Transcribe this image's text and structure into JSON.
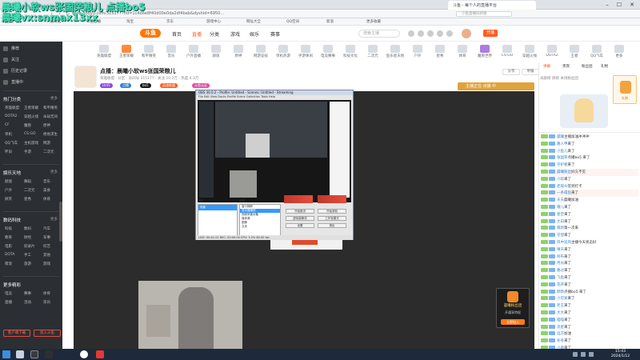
{
  "overlay": {
    "line1": "晨曦小软ws张国荣粮儿 点播bo5",
    "line2": "晨曦vx:snmax13xx"
  },
  "browser": {
    "tab_title": "斗鱼 - 每个人的直播平台",
    "url": "www.douyu.com/315177?rid=1c4d6e8f40d00e0da2df4bab&dyshid=6950...",
    "search_placeholder": "小鱼直播间新版",
    "bookmarks": [
      "百度一下",
      "天猫精选",
      "斗鱼直播",
      "淘宝",
      "京东",
      "游戏中心",
      "网址大全",
      "QQ空间",
      "新浪",
      "更多收藏"
    ]
  },
  "site": {
    "logo": "斗鱼",
    "nav": [
      "首页",
      "直播",
      "分类",
      "游戏",
      "娱乐",
      "赛事"
    ],
    "active_nav": "直播",
    "search_placeholder": "搜索主播",
    "open_live": "开播"
  },
  "categories": {
    "count": "12",
    "count_label": "推荐分类",
    "items": [
      "英雄联盟",
      "王者荣耀",
      "和平精英",
      "音乐",
      "户外直播",
      "颜值",
      "原神",
      "网游竞技",
      "单机热游",
      "手游休闲",
      "电竞赛事",
      "科技文化",
      "二次元",
      "鱼乐星天地",
      "户外",
      "星秀",
      "体育",
      "魔兽世界",
      "CS:GO",
      "穿越火线",
      "DOTA2",
      "王者",
      "QQ飞车",
      "更多"
    ]
  },
  "sidebar": {
    "top_items": [
      "推荐",
      "关注",
      "历史记录",
      "直播中"
    ],
    "sections": [
      {
        "title": "热门分类",
        "more": "更多",
        "cells": [
          "英雄联盟",
          "王者荣耀",
          "和平精英",
          "DOTA2",
          "穿越火线",
          "永劫无间",
          "CF",
          "魔兽",
          "原神",
          "单机",
          "CS:GO",
          "绝地求生",
          "QQ飞车",
          "主机游戏",
          "网游",
          "怀旧",
          "手游",
          "二次元"
        ]
      },
      {
        "title": "娱乐天地",
        "more": "更多",
        "cells": [
          "颜值",
          "舞蹈",
          "音乐",
          "户外",
          "二次元",
          "美食",
          "搞笑",
          "星秀",
          "体育"
        ]
      },
      {
        "title": "数码科技",
        "more": "更多",
        "cells": [
          "科技",
          "数码",
          "汽车",
          "教育",
          "财经",
          "军事",
          "电影",
          "纪录片",
          "综艺",
          "DOTA",
          "手工",
          "其他",
          "萌宠",
          "旅游",
          "游戏"
        ]
      },
      {
        "title": "更多精彩",
        "more": "",
        "cells": [
          "电竞",
          "赛事",
          "体育",
          "直播",
          "活动",
          "资讯"
        ]
      }
    ],
    "footer_buttons": [
      "客户端下载",
      "加入斗鱼"
    ]
  },
  "room": {
    "title": "点播：晨曦小软ws张国荣粮儿",
    "sub": "英雄联盟 · 分区 · 房间号 315177 · 关注 10.2万 · 热度 4.3万",
    "tags": [
      "LV45",
      "点播",
      "bo5",
      "英雄联盟",
      "斗鱼认证"
    ],
    "buttons": [
      "分享",
      "举报"
    ],
    "banner": "主播正在 点播 中"
  },
  "video": {
    "obs_title": "OBS 30.0.2 - Profile: Untitled - Scenes: Untitled - Streaming",
    "obs_menu": "File Edit View Docks Profile Scene Collection Tools Help",
    "obs_status": "LIVE: 00:41:22 REC: 00:00:00 CPU: 3.2% 60.00 fps",
    "scene_label": "场景",
    "source_label": "来源",
    "scenes": [
      "场景"
    ],
    "sources": [
      "窗口捕获",
      "显示器捕获",
      "视频采集设备",
      "媒体源",
      "图像",
      "文本"
    ],
    "controls": [
      "开始推流",
      "开始录制",
      "虚拟摄像机",
      "工作室模式",
      "设置",
      "退出"
    ],
    "gift_title": "晨曦粉丝团",
    "gift_sub": "开通享特权",
    "gift_btn": "立即加入"
  },
  "chat": {
    "tabs": [
      "弹幕",
      "贵宾",
      "粉丝团",
      "礼物"
    ],
    "active_tab": "弹幕",
    "rank_text": "贡献榜 周榜 本场粉丝团",
    "gift_side": "礼物",
    "lines": [
      {
        "name": "晨曦",
        "text": "主播加油冲冲冲",
        "highlight": false
      },
      {
        "name": "路人甲",
        "text": "来了",
        "highlight": false
      },
      {
        "name": "小鱼儿",
        "text": "来了",
        "highlight": false
      },
      {
        "name": "张国荣",
        "text": "点播bo5 来了",
        "highlight": false
      },
      {
        "name": "守护者",
        "text": "来了",
        "highlight": false
      },
      {
        "name": "晨曦粉丝",
        "text": "好久不见",
        "highlight": true
      },
      {
        "name": "小软",
        "text": "来了",
        "highlight": false
      },
      {
        "name": "老观众",
        "text": "签到打卡",
        "highlight": false
      },
      {
        "name": "一条咸鱼",
        "text": "来了",
        "highlight": true
      },
      {
        "name": "天天",
        "text": "晨曦加油",
        "highlight": false
      },
      {
        "name": "粮儿",
        "text": "来了",
        "highlight": false
      },
      {
        "name": "星空",
        "text": "来了",
        "highlight": false
      },
      {
        "name": "大白",
        "text": "来了",
        "highlight": false
      },
      {
        "name": "萌新",
        "text": "第一次来",
        "highlight": false
      },
      {
        "name": "守望",
        "text": "来了",
        "highlight": false
      },
      {
        "name": "风中追风",
        "text": "主播今天状态好",
        "highlight": false
      },
      {
        "name": "晴天",
        "text": "来了",
        "highlight": false
      },
      {
        "name": "阿布",
        "text": "来了",
        "highlight": false
      },
      {
        "name": "月光",
        "text": "来了",
        "highlight": false
      },
      {
        "name": "路过",
        "text": "来了",
        "highlight": false
      },
      {
        "name": "飞鱼",
        "text": "来了",
        "highlight": false
      },
      {
        "name": "花开",
        "text": "来了",
        "highlight": false
      },
      {
        "name": "默默",
        "text": "点播bo5 来了",
        "highlight": false
      },
      {
        "name": "小可爱",
        "text": "来了",
        "highlight": false
      },
      {
        "name": "老王",
        "text": "来了",
        "highlight": false
      },
      {
        "name": "大大",
        "text": "来了",
        "highlight": false
      },
      {
        "name": "喵喵",
        "text": "来了",
        "highlight": false
      },
      {
        "name": "流星",
        "text": "来了",
        "highlight": false
      },
      {
        "name": "远方",
        "text": "加油",
        "highlight": false
      },
      {
        "name": "冬冬",
        "text": "来了",
        "highlight": false
      },
      {
        "name": "小鹿",
        "text": "来了",
        "highlight": false
      }
    ]
  },
  "taskbar": {
    "time": "15:43",
    "date": "2024/1/12"
  },
  "colors": {
    "accent": "#ff5d23",
    "sidebar_bg": "#2b2f33",
    "overlay_text": "#3fe0b8",
    "video_bg": "#2c2c2c"
  }
}
